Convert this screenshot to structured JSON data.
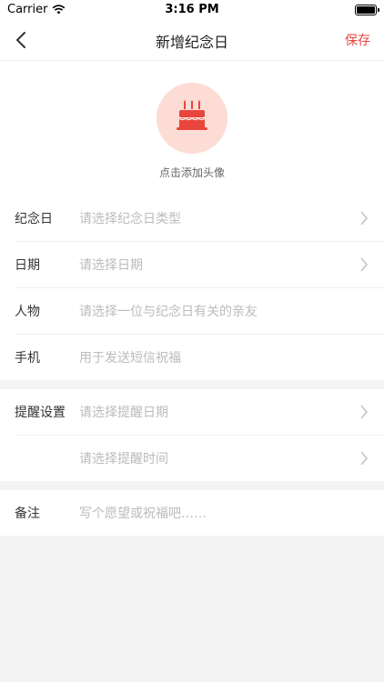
{
  "status": {
    "carrier": "Carrier",
    "time": "3:16 PM"
  },
  "nav": {
    "title": "新增纪念日",
    "save_label": "保存"
  },
  "avatar": {
    "caption": "点击添加头像",
    "icon": "cake-icon",
    "accent": "#e8453c",
    "bg": "#fddcd6"
  },
  "form": {
    "anniversary": {
      "label": "纪念日",
      "placeholder": "请选择纪念日类型"
    },
    "date": {
      "label": "日期",
      "placeholder": "请选择日期"
    },
    "person": {
      "label": "人物",
      "placeholder": "请选择一位与纪念日有关的亲友"
    },
    "phone": {
      "label": "手机",
      "placeholder": "用于发送短信祝福"
    },
    "reminder": {
      "label": "提醒设置",
      "date_placeholder": "请选择提醒日期",
      "time_placeholder": "请选择提醒时间"
    },
    "note": {
      "label": "备注",
      "placeholder": "写个愿望或祝福吧……"
    }
  }
}
